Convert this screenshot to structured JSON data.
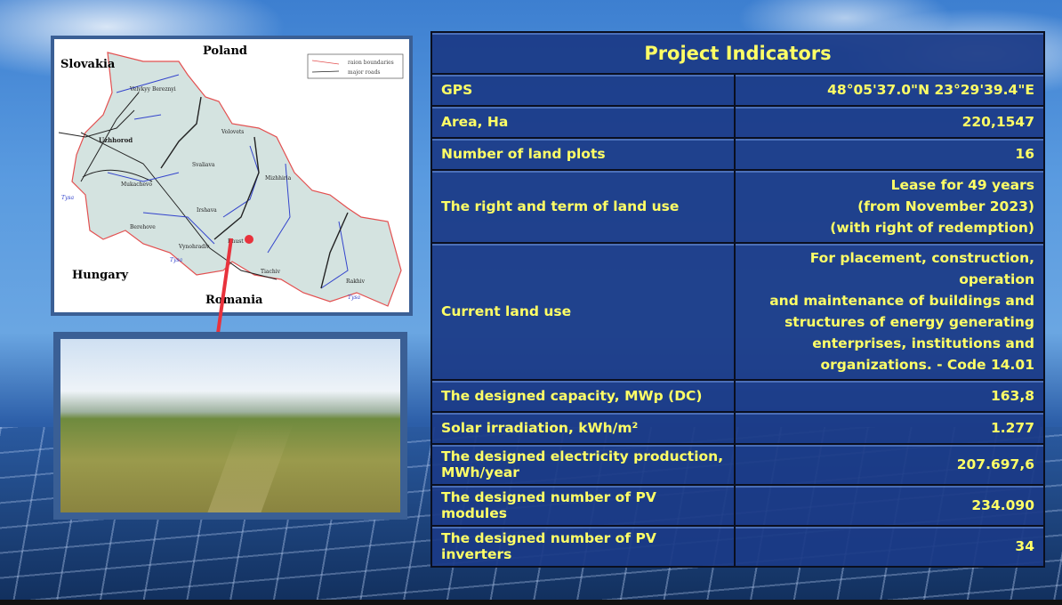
{
  "map": {
    "countries": [
      "Slovakia",
      "Poland",
      "Hungary",
      "Romania"
    ],
    "legend": [
      "raion boundaries",
      "major roads"
    ],
    "cities": [
      "Velykyy Bereznyi",
      "Uzhhorod",
      "Volovets",
      "Svaliava",
      "Mukachevo",
      "Mizhhiria",
      "Irshava",
      "Berehove",
      "Vynohradiv",
      "Khust",
      "Tiachiv",
      "Rakhiv"
    ],
    "rivers": [
      "Tysa",
      "Tysa",
      "Tysa"
    ]
  },
  "table": {
    "title": "Project  Indicators",
    "rows": [
      {
        "label": "GPS",
        "value": "48°05'37.0\"N 23°29'39.4\"E"
      },
      {
        "label": "Area, Ha",
        "value": "220,1547"
      },
      {
        "label": "Number of land plots",
        "value": "16"
      },
      {
        "label": "The right and term of land use",
        "value": [
          "Lease for 49 years",
          "(from November 2023)",
          "(with right of redemption)"
        ]
      },
      {
        "label": "Current land use",
        "value": [
          "For placement, construction, operation",
          "and maintenance of buildings and",
          "structures of energy generating",
          "enterprises, institutions and",
          "organizations. - Code 14.01"
        ]
      },
      {
        "label": "The designed capacity, MWp (DC)",
        "value": "163,8"
      },
      {
        "label": "Solar irradiation, kWh/m²",
        "value": "1.277"
      },
      {
        "label": "The designed electricity production, MWh/year",
        "value": "207.697,6"
      },
      {
        "label": "The designed number of PV modules",
        "value": "234.090"
      },
      {
        "label": "The designed number of PV inverters",
        "value": "34"
      }
    ]
  },
  "colors": {
    "text": "#ffff66",
    "cell": "#1b3a87",
    "pin": "#e8323c"
  }
}
